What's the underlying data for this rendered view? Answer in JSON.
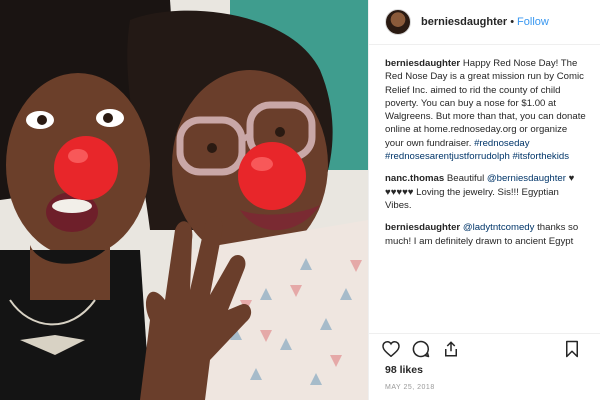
{
  "header": {
    "username": "berniesdaughter",
    "separator": "•",
    "follow_label": "Follow"
  },
  "caption": {
    "username": "berniesdaughter",
    "text": "Happy Red Nose Day! The Red Nose Day is a great mission run by Comic Relief Inc. aimed to rid the county of child poverty. You can buy a nose for $1.00 at Walgreens. But more than that, you can donate online at home.rednoseday.org or organize your own fundraiser. ",
    "hashtags": "#rednoseday #rednosesarentjustforrudolph #itsforthekids"
  },
  "comments": [
    {
      "username": "nanc.thomas",
      "pre": "Beautiful ",
      "mention": "@berniesdaughter",
      "post": " ♥ ♥♥♥♥♥ Loving the jewelry. Sis!!! Egyptian Vibes."
    },
    {
      "username": "berniesdaughter",
      "pre": "",
      "mention": "@ladytntcomedy",
      "post": " thanks so much! I am definitely drawn to ancient Egypt"
    }
  ],
  "stats": {
    "likes": "98 likes",
    "date": "MAY 25, 2018"
  },
  "icons": [
    "heart-icon",
    "comment-icon",
    "share-icon",
    "bookmark-icon"
  ],
  "colors": {
    "link": "#3897f0",
    "hashtag": "#003569",
    "nose_red": "#e8262a"
  }
}
